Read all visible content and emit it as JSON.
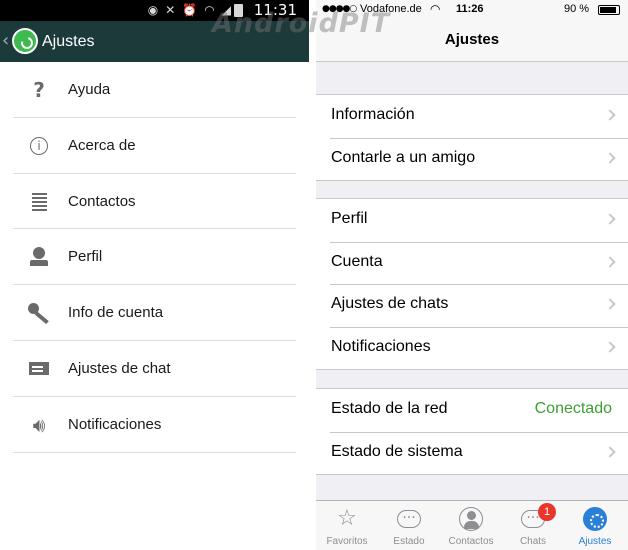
{
  "android": {
    "status": {
      "time": "11:31",
      "icons": [
        "eye-icon",
        "mute-icon",
        "alarm-icon",
        "wifi-icon",
        "signal-icon",
        "battery-icon"
      ]
    },
    "header": {
      "title": "Ajustes"
    },
    "items": [
      {
        "label": "Ayuda",
        "icon": "help-icon"
      },
      {
        "label": "Acerca de",
        "icon": "info-icon"
      },
      {
        "label": "Contactos",
        "icon": "contacts-icon"
      },
      {
        "label": "Perfil",
        "icon": "profile-icon"
      },
      {
        "label": "Info de cuenta",
        "icon": "key-icon"
      },
      {
        "label": "Ajustes de chat",
        "icon": "chat-settings-icon"
      },
      {
        "label": "Notificaciones",
        "icon": "speaker-icon"
      }
    ],
    "colors": {
      "header_bg": "#1d3a3b",
      "status_bg": "#000000",
      "logo": "#3dbb4f"
    }
  },
  "watermark": "AndroidPIT",
  "ios": {
    "status": {
      "carrier": "Vodafone.de",
      "time": "11:26",
      "battery": "90 %"
    },
    "nav": {
      "title": "Ajustes"
    },
    "groups": [
      [
        {
          "label": "Información"
        },
        {
          "label": "Contarle a un amigo"
        }
      ],
      [
        {
          "label": "Perfil"
        },
        {
          "label": "Cuenta"
        },
        {
          "label": "Ajustes de chats"
        },
        {
          "label": "Notificaciones"
        }
      ],
      [
        {
          "label": "Estado de la red",
          "value": "Conectado"
        },
        {
          "label": "Estado de sistema"
        }
      ]
    ],
    "tabs": [
      {
        "label": "Favoritos",
        "icon": "star-icon"
      },
      {
        "label": "Estado",
        "icon": "status-bubble-icon"
      },
      {
        "label": "Contactos",
        "icon": "contacts-person-icon"
      },
      {
        "label": "Chats",
        "icon": "chats-icon",
        "badge": "1"
      },
      {
        "label": "Ajustes",
        "icon": "settings-gear-icon",
        "active": true
      }
    ],
    "colors": {
      "connected": "#3c9f2f",
      "active_tab": "#2a7fd6",
      "badge": "#e8362b"
    }
  }
}
